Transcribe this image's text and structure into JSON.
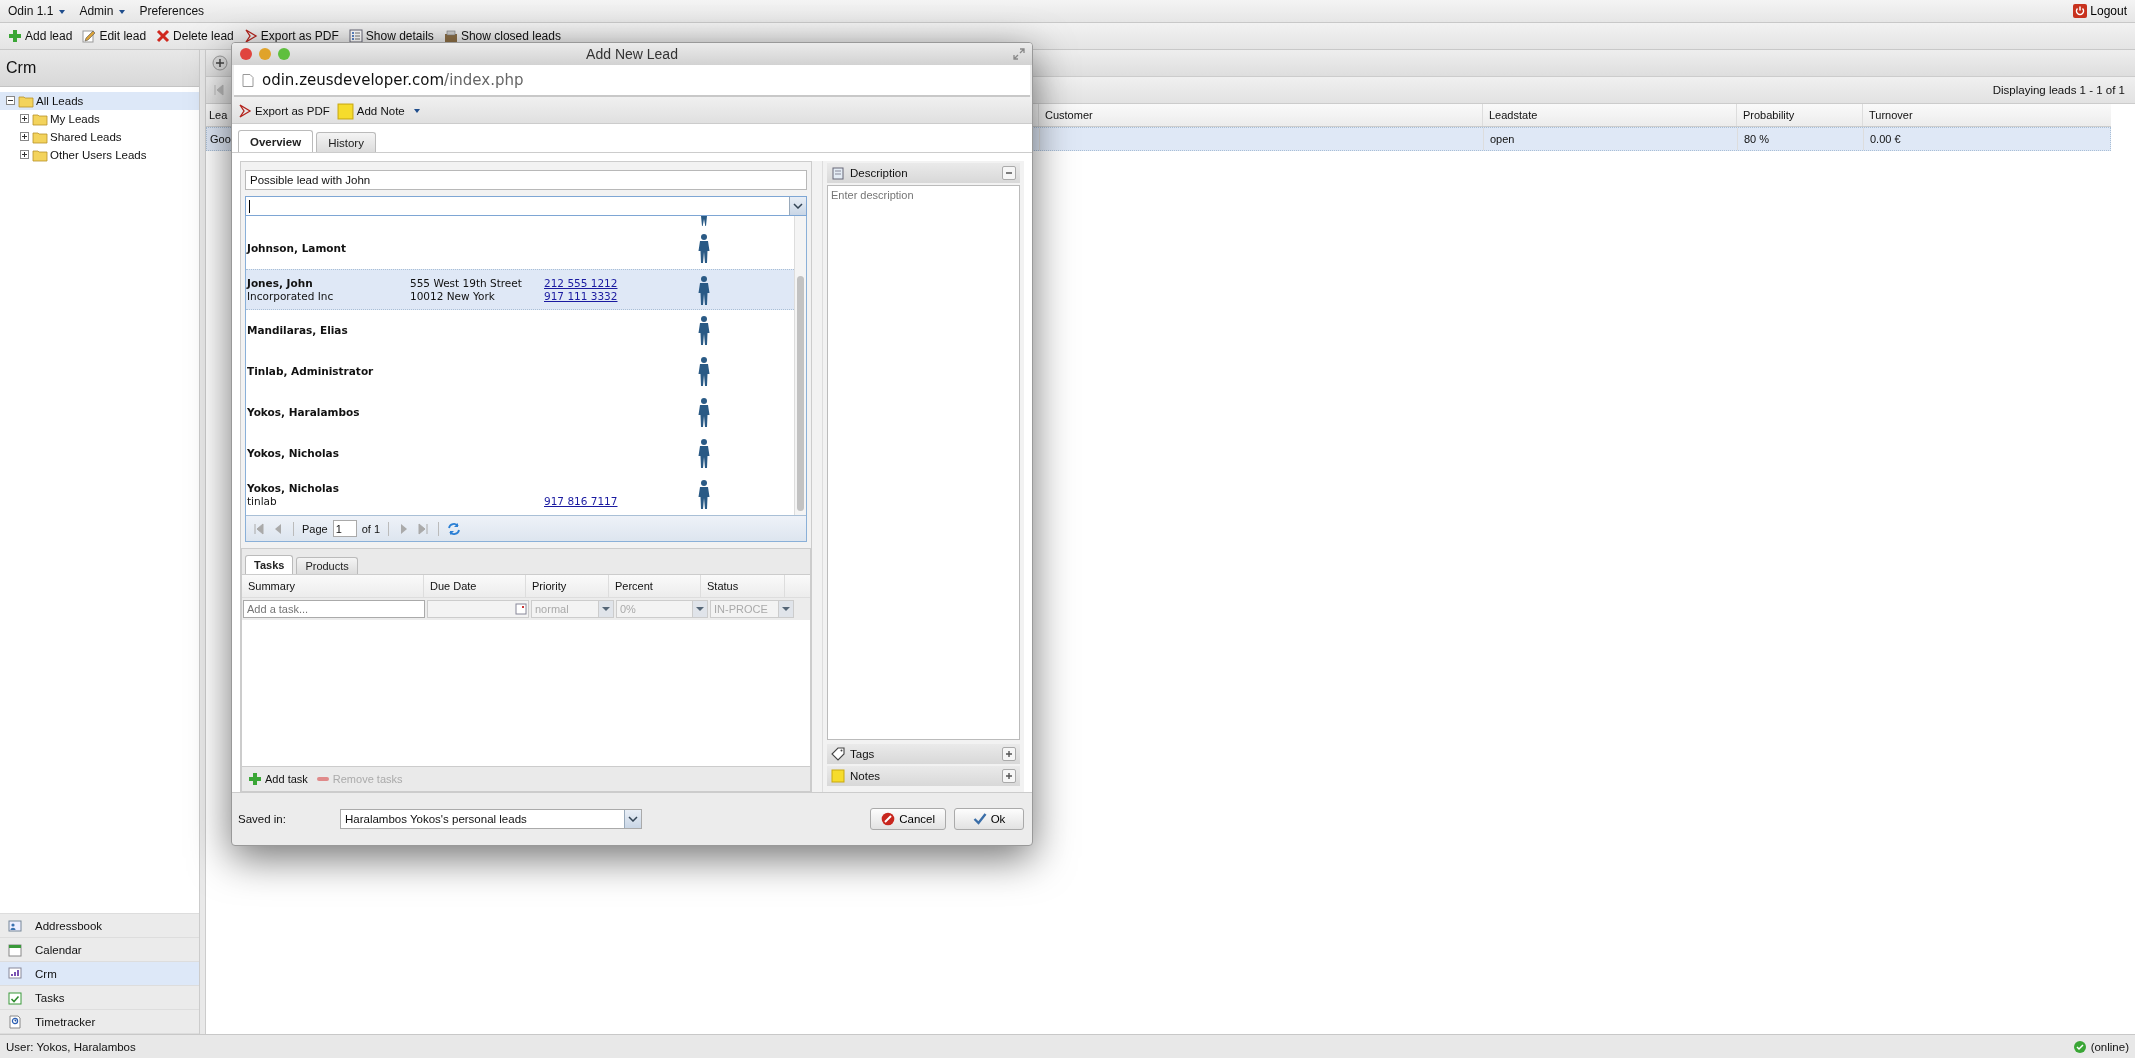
{
  "menu": [
    {
      "label": "Odin 1.1",
      "dropdown": true
    },
    {
      "label": "Admin",
      "dropdown": true
    },
    {
      "label": "Preferences",
      "dropdown": false
    }
  ],
  "logout": "Logout",
  "toolbar": [
    {
      "kind": "add",
      "label": "Add lead"
    },
    {
      "kind": "edit",
      "label": "Edit lead"
    },
    {
      "kind": "delete",
      "label": "Delete lead"
    },
    {
      "kind": "pdf",
      "label": "Export as PDF"
    },
    {
      "kind": "details",
      "label": "Show details"
    },
    {
      "kind": "closed",
      "label": "Show closed leads"
    }
  ],
  "sidebar": {
    "title": "Crm",
    "tree": [
      {
        "label": "All Leads",
        "expanded": true,
        "selected": true,
        "children": [
          {
            "label": "My Leads",
            "expanded": false,
            "selected": false
          },
          {
            "label": "Shared Leads",
            "expanded": false,
            "selected": false
          },
          {
            "label": "Other Users Leads",
            "expanded": false,
            "selected": false
          }
        ]
      }
    ],
    "nav": [
      {
        "kind": "addressbook",
        "label": "Addressbook",
        "selected": false
      },
      {
        "kind": "calendar",
        "label": "Calendar",
        "selected": false
      },
      {
        "kind": "crm",
        "label": "Crm",
        "selected": true
      },
      {
        "kind": "tasks",
        "label": "Tasks",
        "selected": false
      },
      {
        "kind": "timetracker",
        "label": "Timetracker",
        "selected": false
      }
    ]
  },
  "grid": {
    "paging_text": "Displaying leads 1 - 1 of 1",
    "columns": [
      "Lea",
      "Customer",
      "Leadstate",
      "Probability",
      "Turnover"
    ],
    "rows": [
      {
        "selected": true,
        "lead": "Goo",
        "leadstate": "open",
        "probability": "80 %",
        "turnover": "0.00 €"
      }
    ]
  },
  "dialog": {
    "title": "Add New Lead",
    "url_host": "odin.zeusdeveloper.com",
    "url_path": "/index.php",
    "toolbar": [
      {
        "kind": "pdf",
        "label": "Export as PDF",
        "dropdown": false
      },
      {
        "kind": "note",
        "label": "Add Note",
        "dropdown": true
      }
    ],
    "tabs": [
      {
        "label": "Overview",
        "selected": true
      },
      {
        "label": "History",
        "selected": false
      }
    ],
    "lead_title": "Possible lead with John",
    "contacts": [
      {
        "selected": false,
        "lines": [
          {
            "text": "Johnson, Lamont"
          }
        ]
      },
      {
        "selected": true,
        "lines": [
          {
            "text": "Jones, John",
            "address": "555 West 19th Street",
            "phone": "212 555 1212"
          },
          {
            "text": "Incorporated Inc",
            "address": "10012 New York",
            "phone": "917 111 3332"
          }
        ]
      },
      {
        "selected": false,
        "lines": [
          {
            "text": "Mandilaras, Elias"
          }
        ]
      },
      {
        "selected": false,
        "lines": [
          {
            "text": "Tinlab, Administrator"
          }
        ]
      },
      {
        "selected": false,
        "lines": [
          {
            "text": "Yokos, Haralambos"
          }
        ]
      },
      {
        "selected": false,
        "lines": [
          {
            "text": "Yokos, Nicholas"
          }
        ]
      },
      {
        "selected": false,
        "lines": [
          {
            "text": "Yokos, Nicholas"
          },
          {
            "text": "tinlab",
            "phone": "917 816 7117"
          }
        ]
      }
    ],
    "paging": {
      "page_label": "Page",
      "page_value": "1",
      "of_label": "of 1"
    },
    "subtabs": [
      {
        "label": "Tasks",
        "selected": true
      },
      {
        "label": "Products",
        "selected": false
      }
    ],
    "task_columns": [
      "Summary",
      "Due Date",
      "Priority",
      "Percent",
      "Status"
    ],
    "task_editor": {
      "placeholder": "Add a task...",
      "priority": "normal",
      "percent": "0%",
      "status": "IN-PROCE"
    },
    "task_actions": [
      {
        "kind": "add",
        "label": "Add task",
        "disabled": false
      },
      {
        "kind": "remove",
        "label": "Remove tasks",
        "disabled": true
      }
    ],
    "description": {
      "title": "Description",
      "placeholder": "Enter description"
    },
    "side_panels": [
      {
        "kind": "tags",
        "label": "Tags"
      },
      {
        "kind": "notes",
        "label": "Notes"
      }
    ],
    "saved_in_label": "Saved in:",
    "saved_in_value": "Haralambos Yokos's personal leads",
    "buttons": [
      {
        "kind": "cancel",
        "label": "Cancel"
      },
      {
        "kind": "ok",
        "label": "Ok"
      }
    ]
  },
  "status_bar": {
    "user": "User: Yokos, Haralambos",
    "connection": "(online)"
  }
}
